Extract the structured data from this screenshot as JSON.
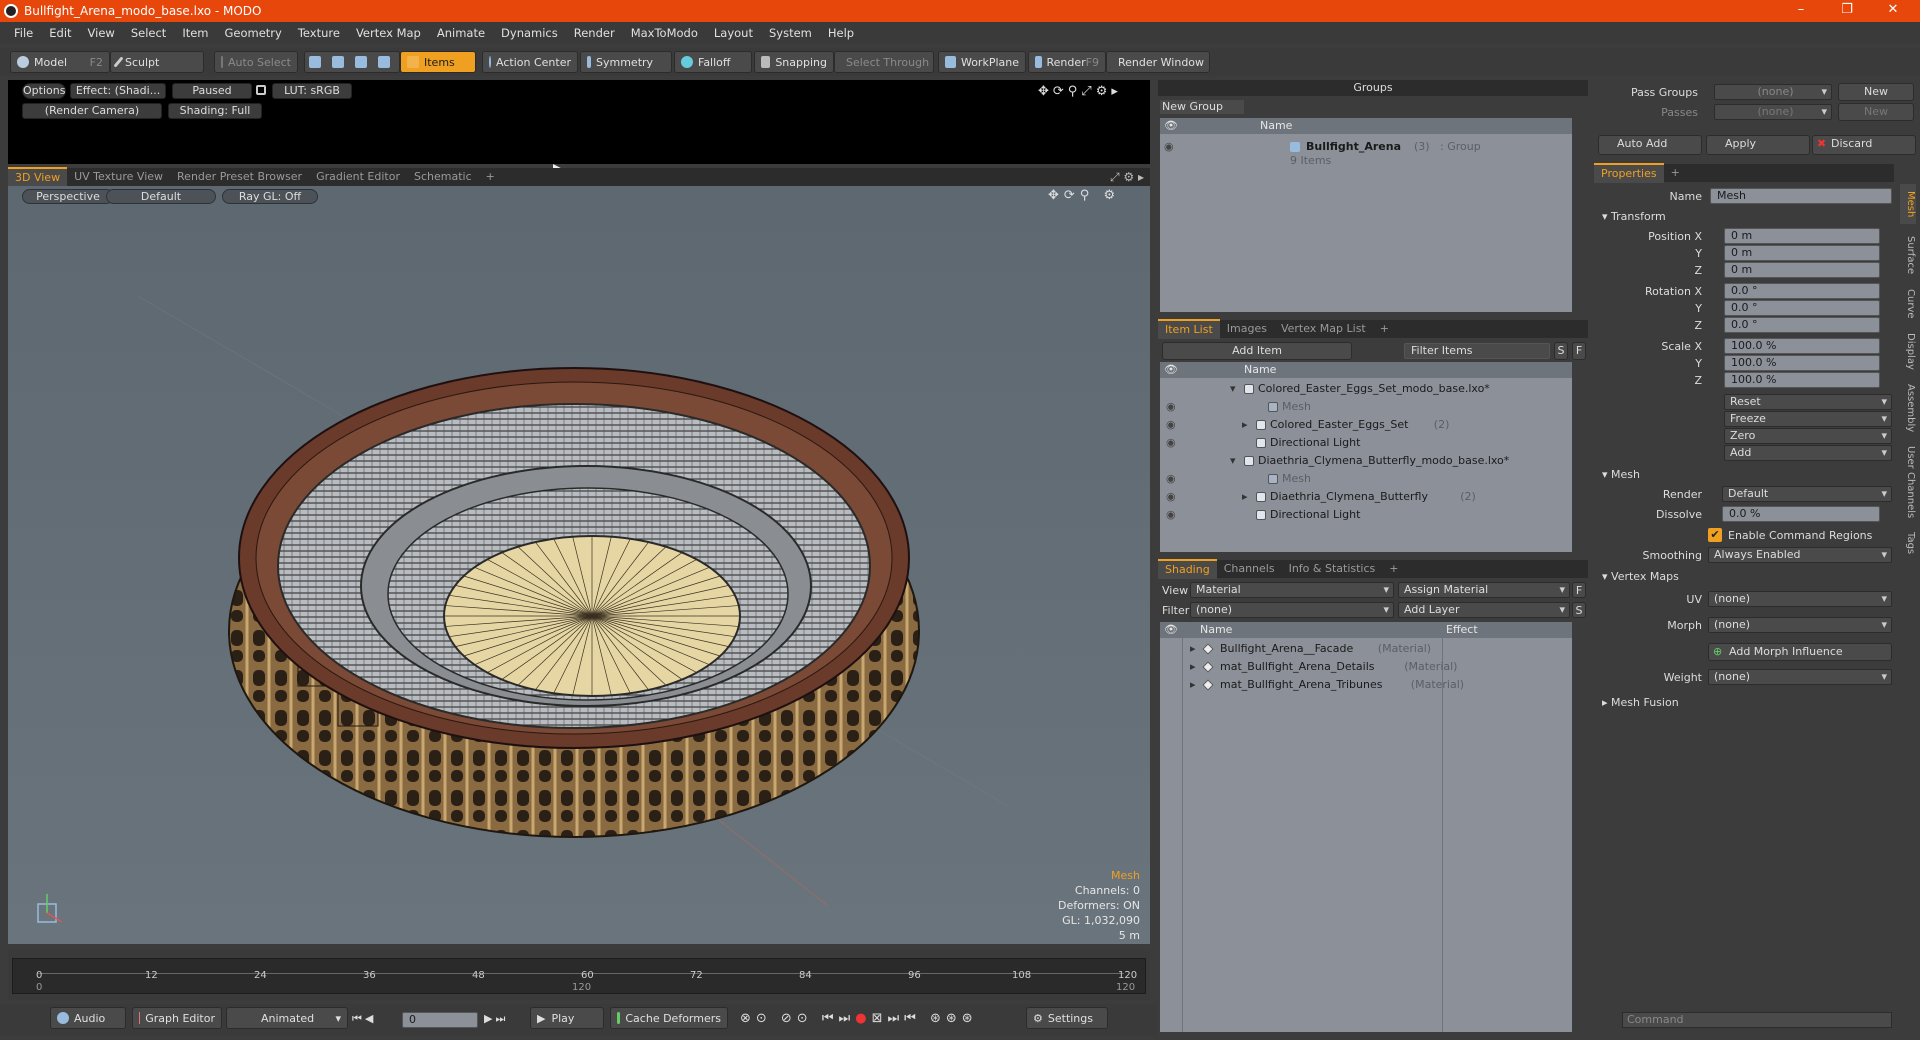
{
  "window": {
    "title": "Bullfight_Arena_modo_base.lxo - MODO",
    "minimize": "–",
    "maximize": "❐",
    "close": "✕"
  },
  "menu": [
    "File",
    "Edit",
    "View",
    "Select",
    "Item",
    "Geometry",
    "Texture",
    "Vertex Map",
    "Animate",
    "Dynamics",
    "Render",
    "MaxToModo",
    "Layout",
    "System",
    "Help"
  ],
  "toolbar": {
    "model": "Model",
    "model_key": "F2",
    "sculpt": "Sculpt",
    "auto_select": "Auto Select",
    "items": "Items",
    "action_center": "Action Center",
    "symmetry": "Symmetry",
    "falloff": "Falloff",
    "snapping": "Snapping",
    "select_through": "Select Through",
    "workplane": "WorkPlane",
    "render": "Render",
    "render_key": "F9",
    "render_window": "Render Window"
  },
  "preview": {
    "options": "Options",
    "effect": "Effect: (Shadi...",
    "paused": "Paused",
    "lut": "LUT: sRGB",
    "camera": "(Render Camera)",
    "shading": "Shading: Full"
  },
  "viewport_tabs": [
    "3D View",
    "UV Texture View",
    "Render Preset Browser",
    "Gradient Editor",
    "Schematic",
    "+"
  ],
  "viewport": {
    "perspective": "Perspective",
    "default": "Default",
    "raygl": "Ray GL: Off",
    "info": {
      "mesh": "Mesh",
      "channels": "Channels: 0",
      "deformers": "Deformers: ON",
      "gl": "GL: 1,032,090",
      "scale": "5 m"
    }
  },
  "timeline": {
    "ticks": [
      "0",
      "12",
      "24",
      "36",
      "48",
      "60",
      "72",
      "84",
      "96",
      "108",
      "120"
    ],
    "start": "0",
    "mid": "120",
    "end": "120"
  },
  "bottom": {
    "audio": "Audio",
    "graph_editor": "Graph Editor",
    "animated": "Animated",
    "frame": "0",
    "play": "Play",
    "cache": "Cache Deformers",
    "settings": "Settings"
  },
  "groups": {
    "title": "Groups",
    "new_group": "New Group",
    "col_name": "Name",
    "row_name": "Bullfight_Arena",
    "row_count": "(3)",
    "row_type": ": Group",
    "row_items": "9 Items"
  },
  "itemlist": {
    "tabs": [
      "Item List",
      "Images",
      "Vertex Map List",
      "+"
    ],
    "add_item": "Add Item",
    "filter": "Filter Items",
    "s": "S",
    "f": "F",
    "col_name": "Name",
    "rows": [
      {
        "indent": 0,
        "arrow": "▾",
        "label": "Colored_Easter_Eggs_Set_modo_base.lxo*",
        "extra": "",
        "gray": false,
        "eye": false
      },
      {
        "indent": 2,
        "arrow": "",
        "label": "Mesh",
        "extra": "",
        "gray": true,
        "eye": true
      },
      {
        "indent": 1,
        "arrow": "▸",
        "label": "Colored_Easter_Eggs_Set",
        "extra": "(2)",
        "gray": false,
        "eye": true
      },
      {
        "indent": 1,
        "arrow": "",
        "label": "Directional Light",
        "extra": "",
        "gray": false,
        "eye": true
      },
      {
        "indent": 0,
        "arrow": "▾",
        "label": "Diaethria_Clymena_Butterfly_modo_base.lxo*",
        "extra": "",
        "gray": false,
        "eye": false
      },
      {
        "indent": 2,
        "arrow": "",
        "label": "Mesh",
        "extra": "",
        "gray": true,
        "eye": true
      },
      {
        "indent": 1,
        "arrow": "▸",
        "label": "Diaethria_Clymena_Butterfly",
        "extra": "(2)",
        "gray": false,
        "eye": true
      },
      {
        "indent": 1,
        "arrow": "",
        "label": "Directional Light",
        "extra": "",
        "gray": false,
        "eye": true
      }
    ]
  },
  "shading": {
    "tabs": [
      "Shading",
      "Channels",
      "Info & Statistics",
      "+"
    ],
    "view_label": "View",
    "view_value": "Material",
    "assign": "Assign Material",
    "f": "F",
    "filter_label": "Filter",
    "filter_value": "(none)",
    "add_layer": "Add Layer",
    "s": "S",
    "col_name": "Name",
    "col_effect": "Effect",
    "rows": [
      {
        "label": "Bullfight_Arena__Facade",
        "type": "(Material)"
      },
      {
        "label": "mat_Bullfight_Arena_Details",
        "type": "(Material)"
      },
      {
        "label": "mat_Bullfight_Arena_Tribunes",
        "type": "(Material)"
      }
    ]
  },
  "properties": {
    "pass_groups": "Pass Groups",
    "passes": "Passes",
    "none": "(none)",
    "new": "New",
    "auto_add": "Auto Add",
    "apply": "Apply",
    "discard": "Discard",
    "tab": "Properties",
    "plus": "+",
    "name_label": "Name",
    "name_value": "Mesh",
    "transform": "Transform",
    "position_x_label": "Position X",
    "y": "Y",
    "z": "Z",
    "position": [
      "0 m",
      "0 m",
      "0 m"
    ],
    "rotation_x_label": "Rotation X",
    "rotation": [
      "0.0 °",
      "0.0 °",
      "0.0 °"
    ],
    "scale_x_label": "Scale X",
    "scale": [
      "100.0 %",
      "100.0 %",
      "100.0 %"
    ],
    "actions": [
      "Reset",
      "Freeze",
      "Zero",
      "Add"
    ],
    "mesh_section": "Mesh",
    "render_label": "Render",
    "render_value": "Default",
    "dissolve_label": "Dissolve",
    "dissolve_value": "0.0 %",
    "enable_regions": "Enable Command Regions",
    "smoothing_label": "Smoothing",
    "smoothing_value": "Always Enabled",
    "vertex_maps": "Vertex Maps",
    "uv_label": "UV",
    "morph_label": "Morph",
    "add_morph": "Add Morph Influence",
    "weight_label": "Weight",
    "mesh_fusion": "Mesh Fusion",
    "side_tabs": [
      "Mesh",
      "Surface",
      "Curve",
      "Display",
      "Assembly",
      "User Channels",
      "Tags"
    ],
    "command_placeholder": "Command"
  },
  "colors": {
    "accent": "#f0a020",
    "titlebar": "#e8470c",
    "panel": "#3c3c3c",
    "list": "#8c9199"
  }
}
